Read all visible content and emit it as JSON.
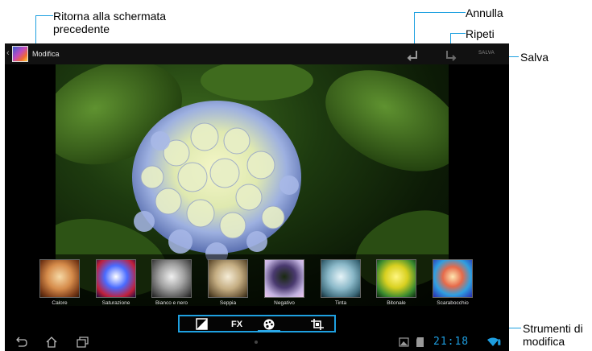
{
  "callouts": {
    "back_line1": "Ritorna alla schermata",
    "back_line2": "precedente",
    "undo": "Annulla",
    "redo": "Ripeti",
    "save": "Salva",
    "tools_line1": "Strumenti di",
    "tools_line2": "modifica"
  },
  "actionbar": {
    "back_glyph": "‹",
    "title": "Modifica",
    "save_label": "SALVA",
    "icons": {
      "undo": "undo-icon",
      "redo": "redo-icon",
      "thumbnail": "app-thumbnail-icon"
    }
  },
  "filters": [
    {
      "label": "Calore"
    },
    {
      "label": "Saturazione"
    },
    {
      "label": "Bianco e nero"
    },
    {
      "label": "Seppia"
    },
    {
      "label": "Negativo"
    },
    {
      "label": "Tinta"
    },
    {
      "label": "Bitonale"
    },
    {
      "label": "Scarabocchio"
    }
  ],
  "tools": {
    "fx_label": "FX",
    "icons": [
      "exposure-icon",
      "fx-icon",
      "color-palette-icon",
      "crop-icon"
    ],
    "selected": "color-palette-icon"
  },
  "navbar": {
    "clock": "21:18",
    "icons": [
      "back-icon",
      "home-icon",
      "recent-apps-icon",
      "gallery-icon",
      "sd-card-icon",
      "wifi-icon",
      "battery-icon"
    ]
  },
  "colors": {
    "accent": "#1ea0e0",
    "clock": "#1e9ee0"
  }
}
